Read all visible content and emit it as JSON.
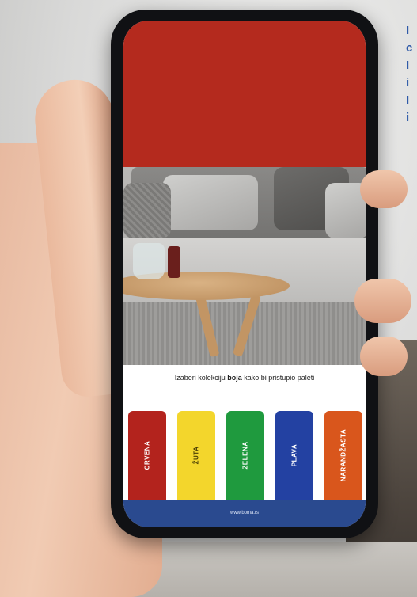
{
  "side_text": [
    "I",
    "c",
    "I",
    "i",
    "I",
    "i"
  ],
  "app": {
    "prompt_before": "Izaberi kolekciju ",
    "prompt_bold": "boja",
    "prompt_after": " kako bi pristupio paleti",
    "collections": [
      {
        "label": "CRVENA",
        "color": "#b3231d"
      },
      {
        "label": "ŽUTA",
        "color": "#f3d62c"
      },
      {
        "label": "ZELENA",
        "color": "#1f9a3e"
      },
      {
        "label": "PLAVA",
        "color": "#2341a2"
      },
      {
        "label": "NARANDŽASTA",
        "color": "#d9561c"
      }
    ],
    "footer_url": "www.boma.rs",
    "wall_color": "#b42a1e",
    "footer_color": "#2a4a8f"
  }
}
